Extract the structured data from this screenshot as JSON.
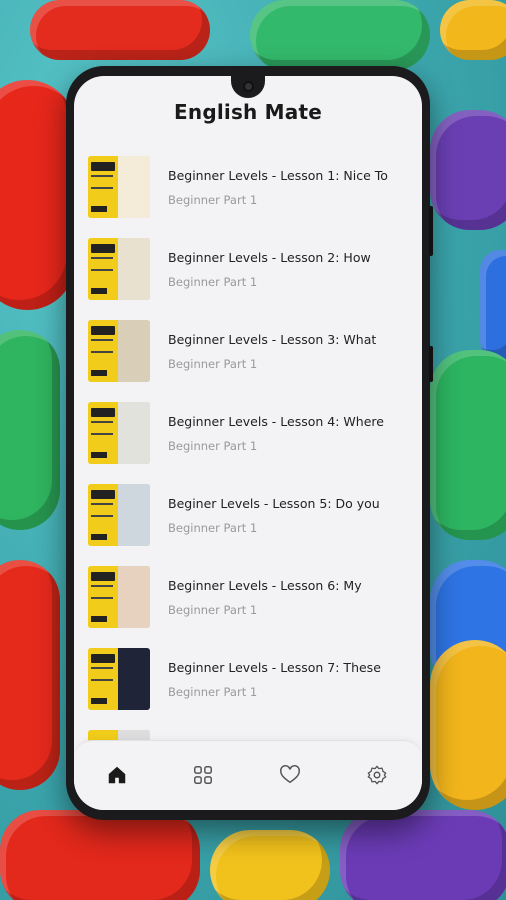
{
  "app": {
    "title": "English Mate"
  },
  "lessons": [
    {
      "title": "Beginner Levels - Lesson 1: Nice To",
      "subtitle": "Beginner Part 1",
      "thumb": "#f4ecd8"
    },
    {
      "title": "Beginner Levels - Lesson 2: How",
      "subtitle": "Beginner Part 1",
      "thumb": "#e8e1d0"
    },
    {
      "title": "Beginner Levels - Lesson 3: What",
      "subtitle": "Beginner Part 1",
      "thumb": "#d9cfb8"
    },
    {
      "title": "Beginner Levels - Lesson 4: Where",
      "subtitle": "Beginner Part 1",
      "thumb": "#e2e2dc"
    },
    {
      "title": "Beginer Levels - Lesson 5: Do you",
      "subtitle": "Beginner Part 1",
      "thumb": "#cfd7de"
    },
    {
      "title": "Beginner Levels - Lesson 6: My",
      "subtitle": "Beginner Part 1",
      "thumb": "#e7d2bf"
    },
    {
      "title": "Beginner Levels - Lesson 7: These",
      "subtitle": "Beginner Part 1",
      "thumb": "#1f2438"
    }
  ],
  "tabs": [
    {
      "icon": "home-icon",
      "active": true
    },
    {
      "icon": "grid-icon",
      "active": false
    },
    {
      "icon": "heart-icon",
      "active": false
    },
    {
      "icon": "gear-icon",
      "active": false
    }
  ],
  "colors": {
    "accent": "#f1cc1a",
    "text": "#222222",
    "muted": "#9a9a9a"
  }
}
